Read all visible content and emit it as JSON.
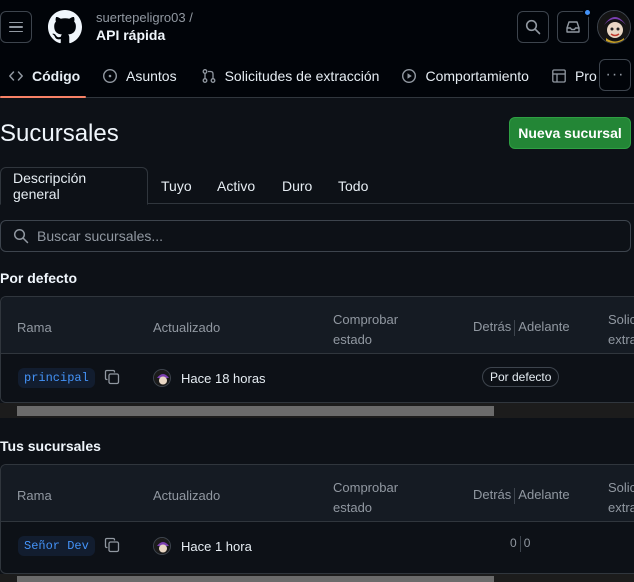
{
  "header": {
    "owner": "suertepeligro03 /",
    "repo": "API rápida"
  },
  "nav_tabs": [
    {
      "label": "Código",
      "icon": "code-icon"
    },
    {
      "label": "Asuntos",
      "icon": "issue-icon"
    },
    {
      "label": "Solicitudes de extracción",
      "icon": "pull-request-icon"
    },
    {
      "label": "Comportamiento",
      "icon": "play-icon"
    },
    {
      "label": "Pro",
      "icon": "table-icon"
    }
  ],
  "page": {
    "title": "Sucursales",
    "new_button": "Nueva sucursal"
  },
  "subtabs": [
    "Descripción general",
    "Tuyo",
    "Activo",
    "Duro",
    "Todo"
  ],
  "search": {
    "placeholder": "Buscar sucursales..."
  },
  "columns": {
    "branch": "Rama",
    "updated": "Actualizado",
    "check1": "Comprobar",
    "check2": "estado",
    "behind": "Detrás",
    "ahead": "Adelante",
    "pr1": "Solic",
    "pr2": "extra"
  },
  "sections": [
    {
      "title": "Por defecto",
      "branch": "principal",
      "updated": "Hace 18 horas",
      "badge": "Por defecto"
    },
    {
      "title": "Tus sucursales",
      "branch": "Señor Dev",
      "updated": "Hace 1 hora",
      "behind": "0",
      "ahead": "0"
    }
  ],
  "colors": {
    "accent": "#f78166",
    "green": "#238636",
    "link": "#4493f8"
  }
}
